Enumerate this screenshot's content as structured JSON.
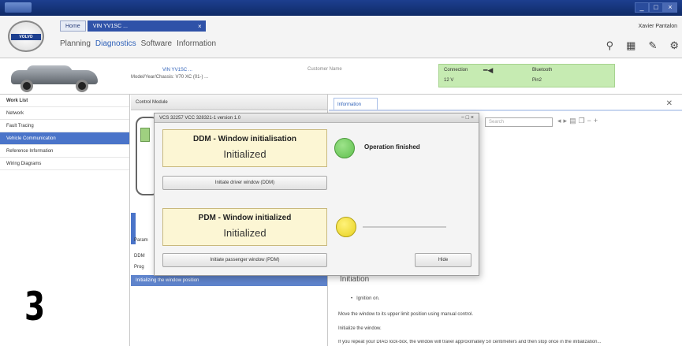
{
  "titlebar": {
    "user_name": "Xavier Pantalon"
  },
  "header": {
    "tabs": [
      {
        "label": "Home"
      },
      {
        "label": "VIN YV1SC ..."
      }
    ],
    "menu": [
      "Planning",
      "Diagnostics",
      "Software",
      "Information"
    ],
    "active_menu": "Diagnostics"
  },
  "vehicle": {
    "vin_line": "VIN YV1SC ...",
    "model_line": "Model/Year/Chassis: V70 XC (01-) ...",
    "customer_label": "Customer Name",
    "connection_label": "Connection",
    "voltage": "12 V",
    "bluetooth_label": "Bluetooth",
    "pin_label": "Pin2"
  },
  "leftnav": {
    "items": [
      {
        "label": "Work List"
      },
      {
        "label": "Network"
      },
      {
        "label": "Fault Tracing"
      },
      {
        "label": "Vehicle Communication"
      },
      {
        "label": "Reference Information"
      },
      {
        "label": "Wiring Diagrams"
      }
    ],
    "active_index": 3
  },
  "cm_panel": {
    "header": "Control Module",
    "row_param": "Param",
    "row_ddm": "DDM",
    "row_prog": "Prog",
    "init_bar": "Initializing the window position"
  },
  "info_panel": {
    "tab_label": "Information",
    "search_placeholder": "Search",
    "section_title": "Initiation",
    "lines": [
      "Ignition on.",
      "Move the window to its upper limit position using manual control.",
      "Initialize the window.",
      "If you repeat your DIAG lock-box, the window will travel approximately 50 centimeters and then stop once in the initialization..."
    ]
  },
  "dialog": {
    "title": "VCS 32257   VCC 328321-1  version 1.0",
    "controls": "− □ ×",
    "ddm_title": "DDM - Window initialisation",
    "ddm_status": "Initialized",
    "ddm_button": "Initiate driver window (DDM)",
    "pdm_title": "PDM - Window initialized",
    "pdm_status": "Initialized",
    "pdm_button": "Initiate passenger window (PDM)",
    "operation_status": "Operation finished",
    "hide_button": "Hide",
    "progress": 0.0
  },
  "overlay": {
    "step_number": "3"
  },
  "colors": {
    "accent": "#2f52a8",
    "green_lamp": "#5fbf4e",
    "yellow_lamp": "#e7d11f",
    "status_box": "#c6ebb2"
  }
}
